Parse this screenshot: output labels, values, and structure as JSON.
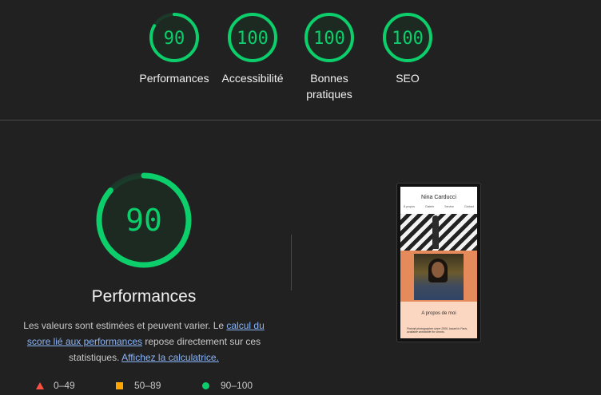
{
  "categories": [
    {
      "score": "90",
      "value": 90,
      "label_lines": [
        "Performances"
      ]
    },
    {
      "score": "100",
      "value": 100,
      "label_lines": [
        "Accessibilité"
      ]
    },
    {
      "score": "100",
      "value": 100,
      "label_lines": [
        "Bonnes",
        "pratiques"
      ]
    },
    {
      "score": "100",
      "value": 100,
      "label_lines": [
        "SEO"
      ]
    }
  ],
  "performance": {
    "score": "90",
    "value": 90,
    "title": "Performances",
    "desc_part1": "Les valeurs sont estimées et peuvent varier. Le ",
    "desc_link1": "calcul du score lié aux performances",
    "desc_part2": " repose directement sur ces statistiques. ",
    "desc_link2": "Affichez la calculatrice."
  },
  "legend": [
    {
      "shape": "triangle",
      "range": "0–49",
      "color": "#ff4e42"
    },
    {
      "shape": "square",
      "range": "50–89",
      "color": "#ffa400"
    },
    {
      "shape": "circle",
      "range": "90–100",
      "color": "#0cce6b"
    }
  ],
  "screenshot": {
    "site_title": "Nina Carducci",
    "nav": [
      "À propos",
      "Galerie",
      "Service",
      "Contact"
    ],
    "about": "A propos de moi",
    "text": "Portrait photographer since 2006, based in Paris, available worldwide for shoots."
  },
  "colors": {
    "pass": "#0cce6b",
    "pass_bg": "#0b3a25",
    "link": "#8ab4f8"
  }
}
